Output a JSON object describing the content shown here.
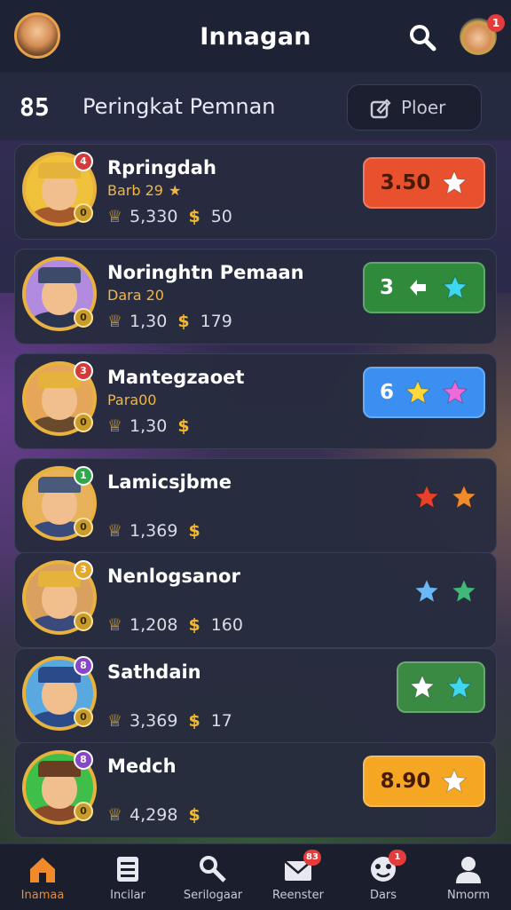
{
  "header": {
    "title": "Innagan",
    "notification_count": "1"
  },
  "subheader": {
    "rank_label": "85",
    "section_title_bold": "Peringkat",
    "section_title_rest": "Pemnan",
    "filter_label": "Ploer"
  },
  "players": [
    {
      "name": "Rpringdah",
      "sub": "Barb 29",
      "sub_star": "★",
      "crowns": "5,330",
      "coins": "50",
      "rank_badge": "4",
      "rank_color": "#d43a3a",
      "level": "0",
      "action": {
        "label": "3.50",
        "bg": "#e8502e",
        "icons": [
          "star-white"
        ]
      },
      "hat_color": "#e5b33b",
      "body_color": "#a65a2c",
      "ring_bg": "#f0c23b"
    },
    {
      "name": "Noringhtn Pemaan",
      "sub": "Dara 20",
      "sub_star": "",
      "crowns": "1,30",
      "coins": "179",
      "rank_badge": "",
      "rank_color": "",
      "level": "0",
      "action": {
        "label": "3",
        "bg": "#2f8a3c",
        "icons": [
          "arrow-white",
          "star-cyan"
        ]
      },
      "hat_color": "#3d4a6a",
      "body_color": "#2a3350",
      "ring_bg": "#b08be0"
    },
    {
      "name": "Mantegzaoet",
      "sub": "Para00",
      "sub_star": "",
      "crowns": "1,30",
      "coins": "",
      "rank_badge": "3",
      "rank_color": "#d43a3a",
      "level": "0",
      "action": {
        "label": "6",
        "bg": "#3a8ff0",
        "icons": [
          "star-yellow",
          "star-pink"
        ]
      },
      "hat_color": "#e5b33b",
      "body_color": "#6a4a2c",
      "ring_bg": "#e6a65a"
    },
    {
      "name": "Lamicsjbme",
      "sub": "",
      "sub_star": "",
      "crowns": "1,369",
      "coins": "",
      "rank_badge": "1",
      "rank_color": "#2fa84a",
      "level": "0",
      "action": {
        "label": "",
        "bg": "transparent",
        "icons": [
          "star-red",
          "star-orange"
        ]
      },
      "hat_color": "#4a5a7a",
      "body_color": "#3a4a7a",
      "ring_bg": "#e8b25a"
    },
    {
      "name": "Nenlogsanor",
      "sub": "",
      "sub_star": "",
      "crowns": "1,208",
      "coins": "160",
      "rank_badge": "3",
      "rank_color": "#e6a62a",
      "level": "0",
      "action": {
        "label": "",
        "bg": "transparent",
        "icons": [
          "star-blue",
          "star-green"
        ]
      },
      "hat_color": "#e5b33b",
      "body_color": "#3a4a7a",
      "ring_bg": "#d9a060"
    },
    {
      "name": "Sathdain",
      "sub": "",
      "sub_star": "",
      "crowns": "3,369",
      "coins": "17",
      "rank_badge": "8",
      "rank_color": "#8a46c8",
      "level": "0",
      "action": {
        "label": "",
        "bg": "#3b8a44",
        "icons": [
          "star-white",
          "star-cyan"
        ]
      },
      "hat_color": "#2b4a8a",
      "body_color": "#2b4a8a",
      "ring_bg": "#5aa8e0"
    },
    {
      "name": "Medch",
      "sub": "",
      "sub_star": "",
      "crowns": "4,298",
      "coins": "",
      "rank_badge": "8",
      "rank_color": "#8a46c8",
      "level": "0",
      "action": {
        "label": "8.90",
        "bg": "#f5a623",
        "icons": [
          "star-white"
        ]
      },
      "hat_color": "#6a3e22",
      "body_color": "#8a4a2a",
      "ring_bg": "#3fbf4a"
    }
  ],
  "tabs": [
    {
      "label": "Inamaa",
      "icon": "home-icon",
      "badge": "",
      "active": true
    },
    {
      "label": "Incilar",
      "icon": "list-icon",
      "badge": ""
    },
    {
      "label": "Serilogaar",
      "icon": "search-key-icon",
      "badge": ""
    },
    {
      "label": "Reenster",
      "icon": "mail-icon",
      "badge": "83"
    },
    {
      "label": "Dars",
      "icon": "mask-icon",
      "badge": "1"
    },
    {
      "label": "Nmorm",
      "icon": "profile-icon",
      "badge": ""
    }
  ],
  "colors": {
    "accent": "#e8b23d",
    "topbar": "#1e2235",
    "row_bg": "#282c3e"
  }
}
